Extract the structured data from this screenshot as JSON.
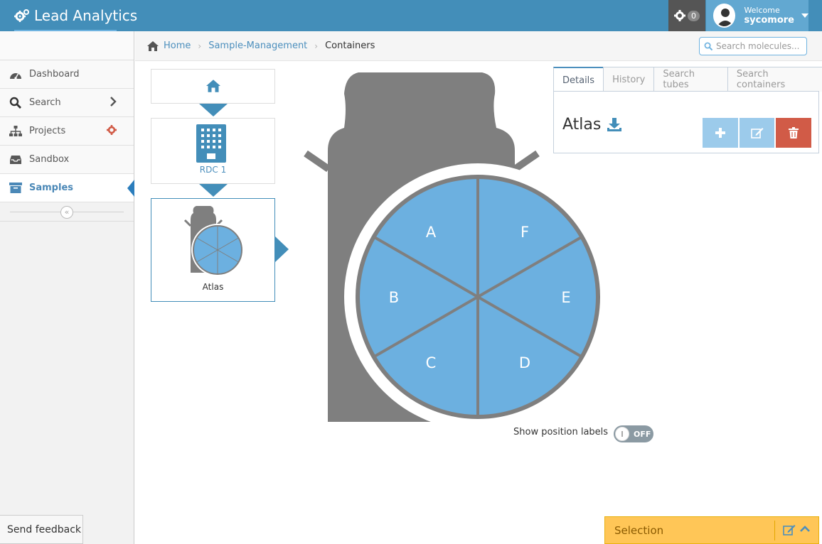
{
  "app": {
    "title": "Lead Analytics"
  },
  "header": {
    "notification_count": "0",
    "welcome": "Welcome",
    "username": "sycomore"
  },
  "sidebar": {
    "items": [
      {
        "label": "Dashboard",
        "icon": "dashboard-icon"
      },
      {
        "label": "Search",
        "icon": "search-icon"
      },
      {
        "label": "Projects",
        "icon": "sitemap-icon"
      },
      {
        "label": "Sandbox",
        "icon": "inbox-icon"
      },
      {
        "label": "Samples",
        "icon": "archive-icon",
        "active": true
      }
    ]
  },
  "breadcrumb": {
    "home": "Home",
    "level1": "Sample-Management",
    "current": "Containers"
  },
  "search": {
    "placeholder": "Search molecules..."
  },
  "hierarchy": {
    "building_label": "RDC 1",
    "container_label": "Atlas"
  },
  "container": {
    "name": "Atlas",
    "positions": [
      "A",
      "B",
      "C",
      "D",
      "E",
      "F"
    ],
    "slot_color": "#6cb0e0",
    "body_color": "#7f7f7f"
  },
  "tabs": [
    "Details",
    "History",
    "Search tubes",
    "Search containers"
  ],
  "details": {
    "title": "Atlas",
    "buttons": {
      "add_color": "#9ccbeb",
      "edit_color": "#9ccbeb",
      "delete_color": "#d15b47"
    }
  },
  "toggle": {
    "label": "Show position labels",
    "state": "OFF"
  },
  "feedback": {
    "label": "Send feedback"
  },
  "selection": {
    "label": "Selection"
  },
  "colors": {
    "accent": "#438eb9",
    "link": "#4c8fbd",
    "warning": "#ffc657"
  }
}
